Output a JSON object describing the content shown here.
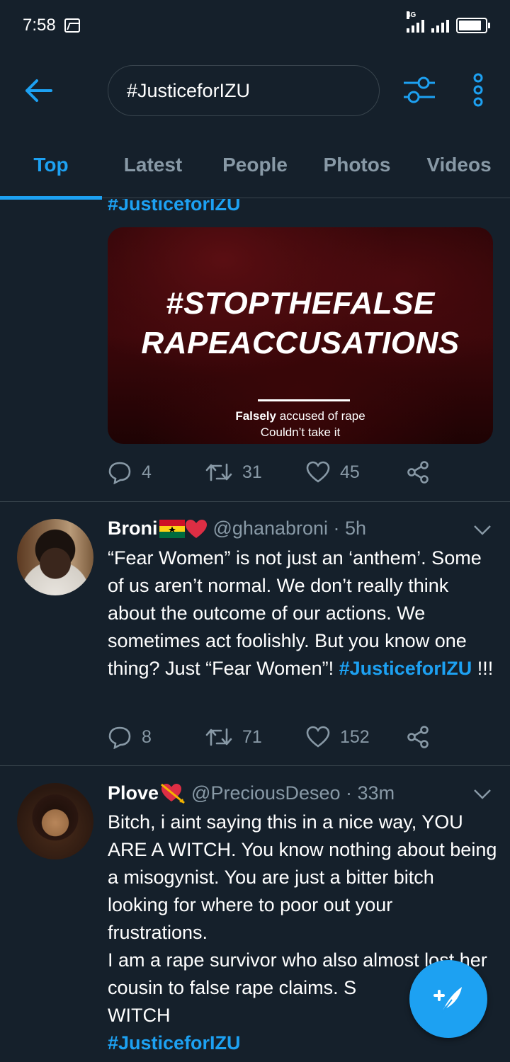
{
  "status_bar": {
    "time": "7:58",
    "network": "4G"
  },
  "header": {
    "search_value": "#JusticeforIZU",
    "back_icon": "arrow-left-icon",
    "filter_icon": "sliders-icon",
    "more_icon": "more-vertical-icon"
  },
  "tabs": [
    {
      "label": "Top",
      "active": true
    },
    {
      "label": "Latest",
      "active": false
    },
    {
      "label": "People",
      "active": false
    },
    {
      "label": "Photos",
      "active": false
    },
    {
      "label": "Videos",
      "active": false
    }
  ],
  "colors": {
    "background": "#15202b",
    "accent": "#1da1f2",
    "muted": "#8899a6",
    "divider": "#38444d"
  },
  "tweets": [
    {
      "hashtag": "#JusticeforIZU",
      "media": {
        "headline_line1": "#STOPTHEFALSE",
        "headline_line2": "RAPEACCUSATIONS",
        "caption_bold": "Falsely",
        "caption_rest": " accused of rape",
        "caption_line2": "Couldn’t take it"
      },
      "replies": "4",
      "retweets": "31",
      "likes": "45"
    },
    {
      "name": "Broni",
      "handle": "@ghanabroni · 5h",
      "body": "“Fear Women”  is not just an ‘anthem’. Some of us aren’t normal. We don’t really think about the outcome of our actions. We sometimes act foolishly. But you know one thing? Just “Fear Women”!",
      "hashtag": "#JusticeforIZU",
      "after_hashtag": " !!!",
      "replies": "8",
      "retweets": "71",
      "likes": "152"
    },
    {
      "name": "Plove",
      "handle": "@PreciousDeseo · 33m",
      "body1": "Bitch, i aint saying this in a nice way, YOU ARE A WITCH. You know nothing about being a misogynist. You are just a bitter bitch looking for where to poor out your frustrations.",
      "body2": "I am a rape survivor who also almost lost her cousin to false rape claims. S",
      "body3": "WITCH",
      "hashtag": "#JusticeforIZU"
    }
  ],
  "fab": {
    "icon": "compose-feather-icon"
  }
}
